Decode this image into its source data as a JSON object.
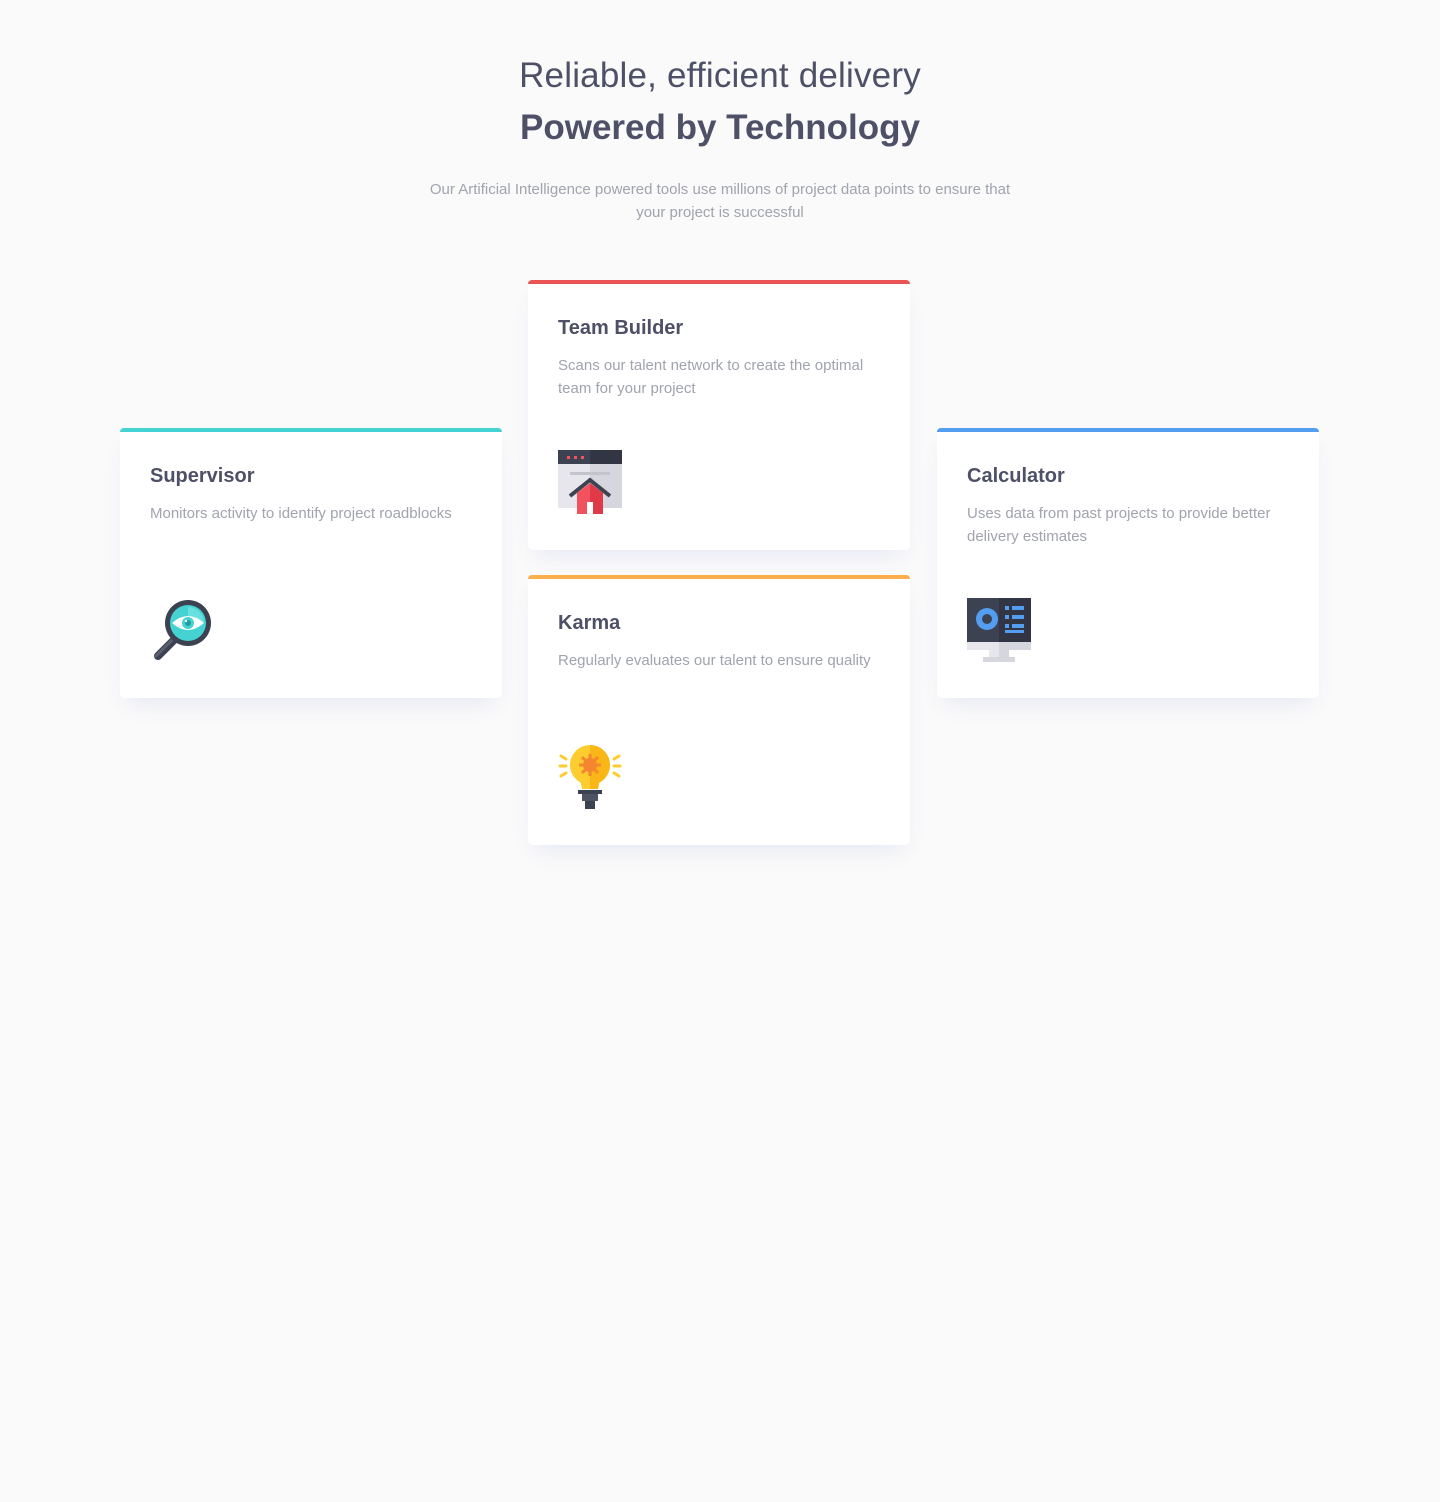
{
  "header": {
    "tagline": "Reliable, efficient delivery",
    "headline": "Powered by Technology",
    "intro": "Our Artificial Intelligence powered tools use millions of project data points to ensure that your project is successful"
  },
  "cards": [
    {
      "title": "Supervisor",
      "description": "Monitors activity to identify project roadblocks",
      "icon": "magnifier-eye-icon",
      "accent": "#44d3d2"
    },
    {
      "title": "Team Builder",
      "description": "Scans our talent network to create the optimal team for your project",
      "icon": "browser-house-icon",
      "accent": "#ea5454"
    },
    {
      "title": "Karma",
      "description": "Regularly evaluates our talent to ensure quality",
      "icon": "lightbulb-icon",
      "accent": "#fcaf4a"
    },
    {
      "title": "Calculator",
      "description": "Uses data from past projects to provide better delivery estimates",
      "icon": "monitor-dashboard-icon",
      "accent": "#549ef2"
    }
  ]
}
